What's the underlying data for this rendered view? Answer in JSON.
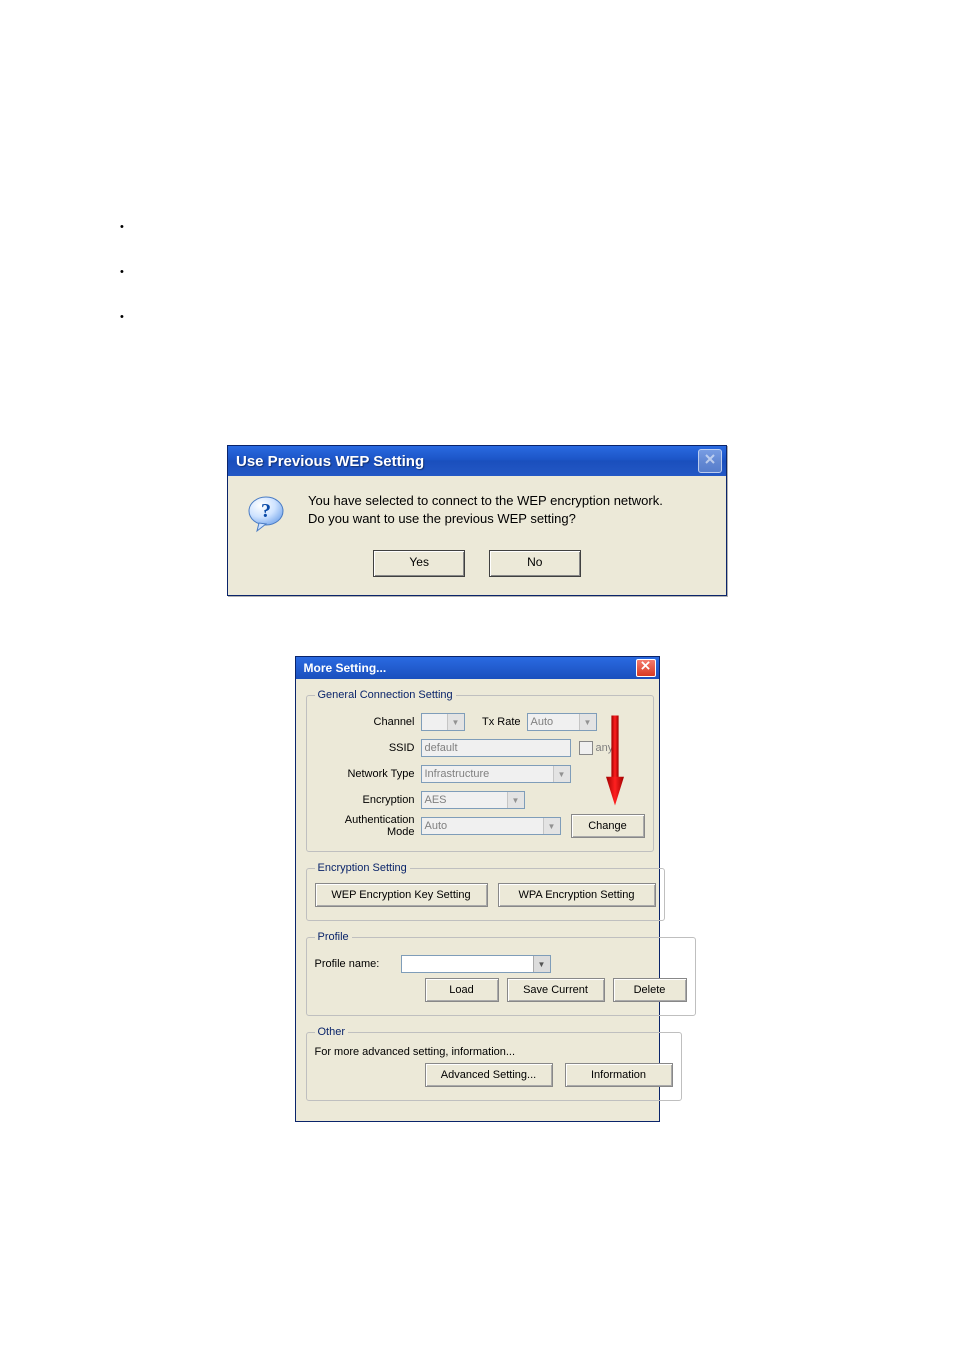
{
  "bullets": [
    "•",
    "•",
    "•"
  ],
  "msgbox": {
    "title": "Use Previous WEP Setting",
    "line1": "You have selected to connect to the WEP encryption network.",
    "line2": "Do you want to use the previous WEP setting?",
    "yes": "Yes",
    "no": "No"
  },
  "more": {
    "title": "More Setting...",
    "groups": {
      "general": {
        "legend": "General Connection Setting",
        "channel_label": "Channel",
        "channel_value": "",
        "txrate_label": "Tx Rate",
        "txrate_value": "Auto",
        "ssid_label": "SSID",
        "ssid_value": "default",
        "any_checkbox": "any",
        "network_type_label": "Network Type",
        "network_type_value": "Infrastructure",
        "encryption_label": "Encryption",
        "encryption_value": "AES",
        "auth_label": "Authentication Mode",
        "auth_value": "Auto",
        "change_btn": "Change"
      },
      "encsetting": {
        "legend": "Encryption Setting",
        "wep_btn": "WEP Encryption Key Setting",
        "wpa_btn": "WPA Encryption Setting"
      },
      "profile": {
        "legend": "Profile",
        "name_label": "Profile name:",
        "name_value": "",
        "load_btn": "Load",
        "save_btn": "Save Current",
        "delete_btn": "Delete"
      },
      "other": {
        "legend": "Other",
        "desc": "For more advanced setting, information...",
        "adv_btn": "Advanced Setting...",
        "info_btn": "Information"
      }
    }
  },
  "colors": {
    "xp_blue": "#1a4fbd",
    "xp_face": "#ece9d8",
    "red_arrow": "#d90000"
  }
}
